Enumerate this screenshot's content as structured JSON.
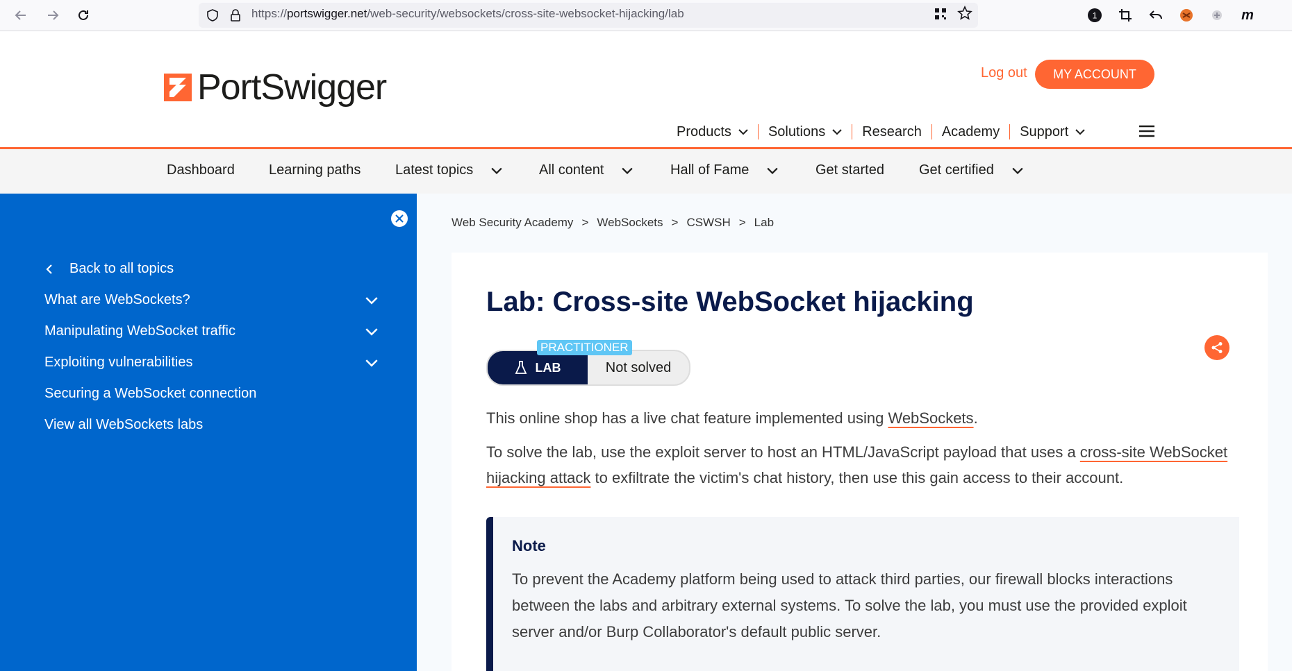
{
  "browser": {
    "url_prefix": "https://",
    "url_host": "portswigger.net",
    "url_path": "/web-security/websockets/cross-site-websocket-hijacking/lab"
  },
  "site": {
    "logo_text": "PortSwigger",
    "logout": "Log out",
    "my_account": "MY ACCOUNT",
    "main_nav": [
      "Products",
      "Solutions",
      "Research",
      "Academy",
      "Support"
    ],
    "sub_nav": [
      "Dashboard",
      "Learning paths",
      "Latest topics",
      "All content",
      "Hall of Fame",
      "Get started",
      "Get certified"
    ]
  },
  "sidebar": {
    "back": "Back to all topics",
    "items": [
      "What are WebSockets?",
      "Manipulating WebSocket traffic",
      "Exploiting vulnerabilities",
      "Securing a WebSocket connection",
      "View all WebSockets labs"
    ]
  },
  "breadcrumb": [
    "Web Security Academy",
    "WebSockets",
    "CSWSH",
    "Lab"
  ],
  "lab": {
    "title": "Lab: Cross-site WebSocket hijacking",
    "level": "PRACTITIONER",
    "badge": "LAB",
    "status": "Not solved",
    "p1_a": "This online shop has a live chat feature implemented using ",
    "p1_link": "WebSockets",
    "p1_b": ".",
    "p2_a": "To solve the lab, use the exploit server to host an HTML/JavaScript payload that uses a ",
    "p2_link": "cross-site WebSocket hijacking attack",
    "p2_b": " to exfiltrate the victim's chat history, then use this gain access to their account.",
    "note_title": "Note",
    "note_body": "To prevent the Academy platform being used to attack third parties, our firewall blocks interactions between the labs and arbitrary external systems. To solve the lab, you must use the provided exploit server and/or Burp Collaborator's default public server."
  },
  "colors": {
    "accent": "#ff6633",
    "sidebar": "#0066cc",
    "navy": "#0a1a4a",
    "level": "#5fc6f5"
  }
}
